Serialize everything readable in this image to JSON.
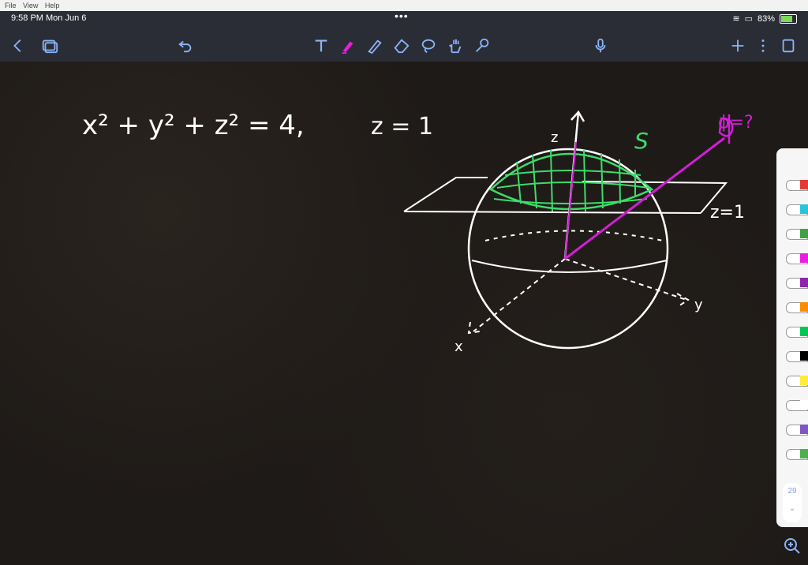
{
  "menubar": {
    "items": [
      "File",
      "View",
      "Help"
    ]
  },
  "status": {
    "time": "9:58 PM  Mon Jun 6",
    "battery": "83%",
    "battery_level": 0.83
  },
  "toolbar": {
    "icons": [
      "back-icon",
      "pages-icon",
      "undo-icon",
      "text-tool-icon",
      "highlighter-icon",
      "pen-icon",
      "eraser-icon",
      "lasso-icon",
      "hand-icon",
      "laser-icon",
      "mic-icon",
      "add-icon",
      "more-icon",
      "page-icon"
    ]
  },
  "canvas": {
    "equation": "x² + y² + z² = 4,",
    "plane": "z = 1",
    "labels": {
      "z_axis": "z",
      "surface": "S",
      "plane_label": "z=1",
      "x_axis": "x",
      "y_axis": "y",
      "phi": "ϕ=?"
    }
  },
  "palette": {
    "colors": [
      "#e53935",
      "#26c6da",
      "#43a047",
      "#e91ee0",
      "#8e24aa",
      "#fb8c00",
      "#00c853",
      "#000000",
      "#ffeb3b",
      "#ffffff",
      "#7e57c2",
      "#4caf50"
    ],
    "page_number": "29"
  }
}
